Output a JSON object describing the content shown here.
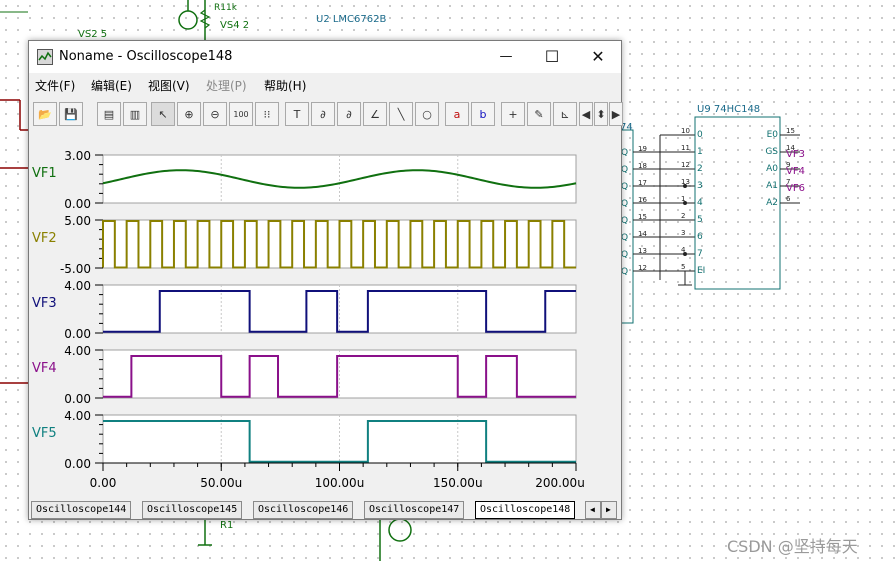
{
  "schematic": {
    "vs_left": "VS2 5",
    "vs_top": "VS4 2",
    "r_top": "R11k",
    "u2": "U2 LMC6762B",
    "u9": "U9 74HC148",
    "chip_left_label": "74",
    "r_bottom": "R1",
    "u9_inputs": [
      "0",
      "1",
      "2",
      "3",
      "4",
      "5",
      "6",
      "7",
      "EI"
    ],
    "u9_input_pins": [
      "10",
      "11",
      "12",
      "13",
      "1",
      "2",
      "3",
      "4",
      "5"
    ],
    "left_pins": [
      "19",
      "18",
      "17",
      "16",
      "15",
      "14",
      "13",
      "12"
    ],
    "left_q": [
      "Q",
      "Q",
      "Q",
      "Q",
      "Q",
      "Q",
      "Q",
      "Q"
    ],
    "u9_outputs": [
      "E0",
      "GS",
      "A0",
      "A1",
      "A2"
    ],
    "u9_output_pins": [
      "15",
      "14",
      "9",
      "7",
      "6"
    ],
    "vf_labels": [
      "VF3",
      "VF4",
      "VF6"
    ],
    "watermark": "CSDN @坚持每天"
  },
  "window": {
    "title": "Noname - Oscilloscope148",
    "min_symbol": "—",
    "max_symbol": "☐",
    "close_symbol": "✕"
  },
  "menu": [
    "文件(F)",
    "编辑(E)",
    "视图(V)",
    "处理(P)",
    "帮助(H)"
  ],
  "toolbar_icons": [
    "open-icon",
    "save-icon",
    "copy-icon",
    "paste-icon",
    "pointer-icon",
    "zoom-in-icon",
    "zoom-out-icon",
    "zoom-100-icon",
    "grid-icon",
    "text-icon",
    "cursor-a-icon",
    "cursor-b-icon",
    "tangent-icon",
    "line-icon",
    "circle-icon",
    "cursor-a-red-icon",
    "cursor-b-blue-icon",
    "add-trace-icon",
    "probe-icon",
    "marker-icon",
    "scroll-left-icon",
    "scroll-updown-icon",
    "scroll-right-icon"
  ],
  "toolbar_glyphs": [
    "📂",
    "💾",
    "▤",
    "▥",
    "↖",
    "⊕",
    "⊖",
    "100",
    "⁝⁝",
    "T",
    "∂",
    "∂",
    "∠",
    "╲",
    "○",
    "a",
    "b",
    "+",
    "✎",
    "⊾",
    "◀",
    "⬍",
    "▶"
  ],
  "chart_data": {
    "type": "line",
    "xlabel": "",
    "x_ticks": [
      "0.00",
      "50.00u",
      "100.00u",
      "150.00u",
      "200.00u"
    ],
    "xlim": [
      0,
      200
    ],
    "series": [
      {
        "name": "VF1",
        "color": "#107010",
        "ylim": [
          0,
          3
        ],
        "y_ticks": [
          "3.00",
          "0.00"
        ],
        "kind": "sine",
        "offset": 1.5,
        "amplitude": 0.55,
        "period": 100,
        "phase_start_frac": 0.17
      },
      {
        "name": "VF2",
        "color": "#8a8000",
        "ylim": [
          -5,
          5
        ],
        "y_ticks": [
          "5.00",
          "-5.00"
        ],
        "kind": "square",
        "high": 4.8,
        "low": -4.9,
        "period": 10,
        "first_edge": 0
      },
      {
        "name": "VF3",
        "color": "#10107a",
        "ylim": [
          0,
          4
        ],
        "y_ticks": [
          "4.00",
          "0.00"
        ],
        "kind": "steps",
        "points": [
          [
            0,
            0.1
          ],
          [
            24,
            0.1
          ],
          [
            24,
            3.5
          ],
          [
            62,
            3.5
          ],
          [
            62,
            0.1
          ],
          [
            86,
            0.1
          ],
          [
            86,
            3.5
          ],
          [
            99,
            3.5
          ],
          [
            99,
            0.1
          ],
          [
            112,
            0.1
          ],
          [
            112,
            3.5
          ],
          [
            162,
            3.5
          ],
          [
            162,
            0.1
          ],
          [
            187,
            0.1
          ],
          [
            187,
            3.5
          ],
          [
            200,
            3.5
          ]
        ]
      },
      {
        "name": "VF4",
        "color": "#8a108a",
        "ylim": [
          0,
          4
        ],
        "y_ticks": [
          "4.00",
          "0.00"
        ],
        "kind": "steps",
        "points": [
          [
            0,
            0.1
          ],
          [
            12,
            0.1
          ],
          [
            12,
            3.5
          ],
          [
            50,
            3.5
          ],
          [
            50,
            0.1
          ],
          [
            62,
            0.1
          ],
          [
            62,
            3.5
          ],
          [
            74,
            3.5
          ],
          [
            74,
            0.1
          ],
          [
            99,
            0.1
          ],
          [
            99,
            3.5
          ],
          [
            150,
            3.5
          ],
          [
            150,
            0.1
          ],
          [
            162,
            0.1
          ],
          [
            162,
            3.5
          ],
          [
            175,
            3.5
          ],
          [
            175,
            0.1
          ],
          [
            200,
            0.1
          ]
        ]
      },
      {
        "name": "VF5",
        "color": "#108080",
        "ylim": [
          0,
          4
        ],
        "y_ticks": [
          "4.00",
          "0.00"
        ],
        "kind": "steps",
        "points": [
          [
            0,
            3.5
          ],
          [
            62,
            3.5
          ],
          [
            62,
            0.1
          ],
          [
            112,
            0.1
          ],
          [
            112,
            3.5
          ],
          [
            162,
            3.5
          ],
          [
            162,
            0.1
          ],
          [
            200,
            0.1
          ]
        ]
      }
    ]
  },
  "tabs": [
    "Oscilloscope144",
    "Oscilloscope145",
    "Oscilloscope146",
    "Oscilloscope147",
    "Oscilloscope148"
  ],
  "active_tab": 4,
  "tab_arrows": [
    "◀",
    "▶"
  ]
}
